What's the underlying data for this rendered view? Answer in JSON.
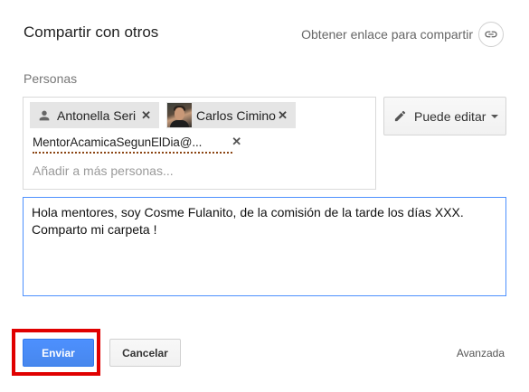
{
  "dialog": {
    "title": "Compartir con otros",
    "get_link_label": "Obtener enlace para compartir",
    "link_icon": "link-icon"
  },
  "people": {
    "section_label": "Personas",
    "chips": [
      {
        "name": "Antonella Seri",
        "icon": "person-icon"
      },
      {
        "name": "Carlos Cimino",
        "icon": "avatar-photo"
      }
    ],
    "pending_email": "MentorAcamicaSegunElDia@...",
    "add_placeholder": "Añadir a más personas..."
  },
  "permission": {
    "label": "Puede editar",
    "icon": "pencil-icon"
  },
  "message": {
    "text": "Hola mentores, soy Cosme Fulanito, de la comisión de la tarde los días XXX.\nComparto mi carpeta !"
  },
  "footer": {
    "send_label": "Enviar",
    "cancel_label": "Cancelar",
    "advanced_label": "Avanzada"
  },
  "colors": {
    "primary_button": "#4d90fe",
    "highlight": "#e00000",
    "focus_border": "#4d90fe"
  }
}
